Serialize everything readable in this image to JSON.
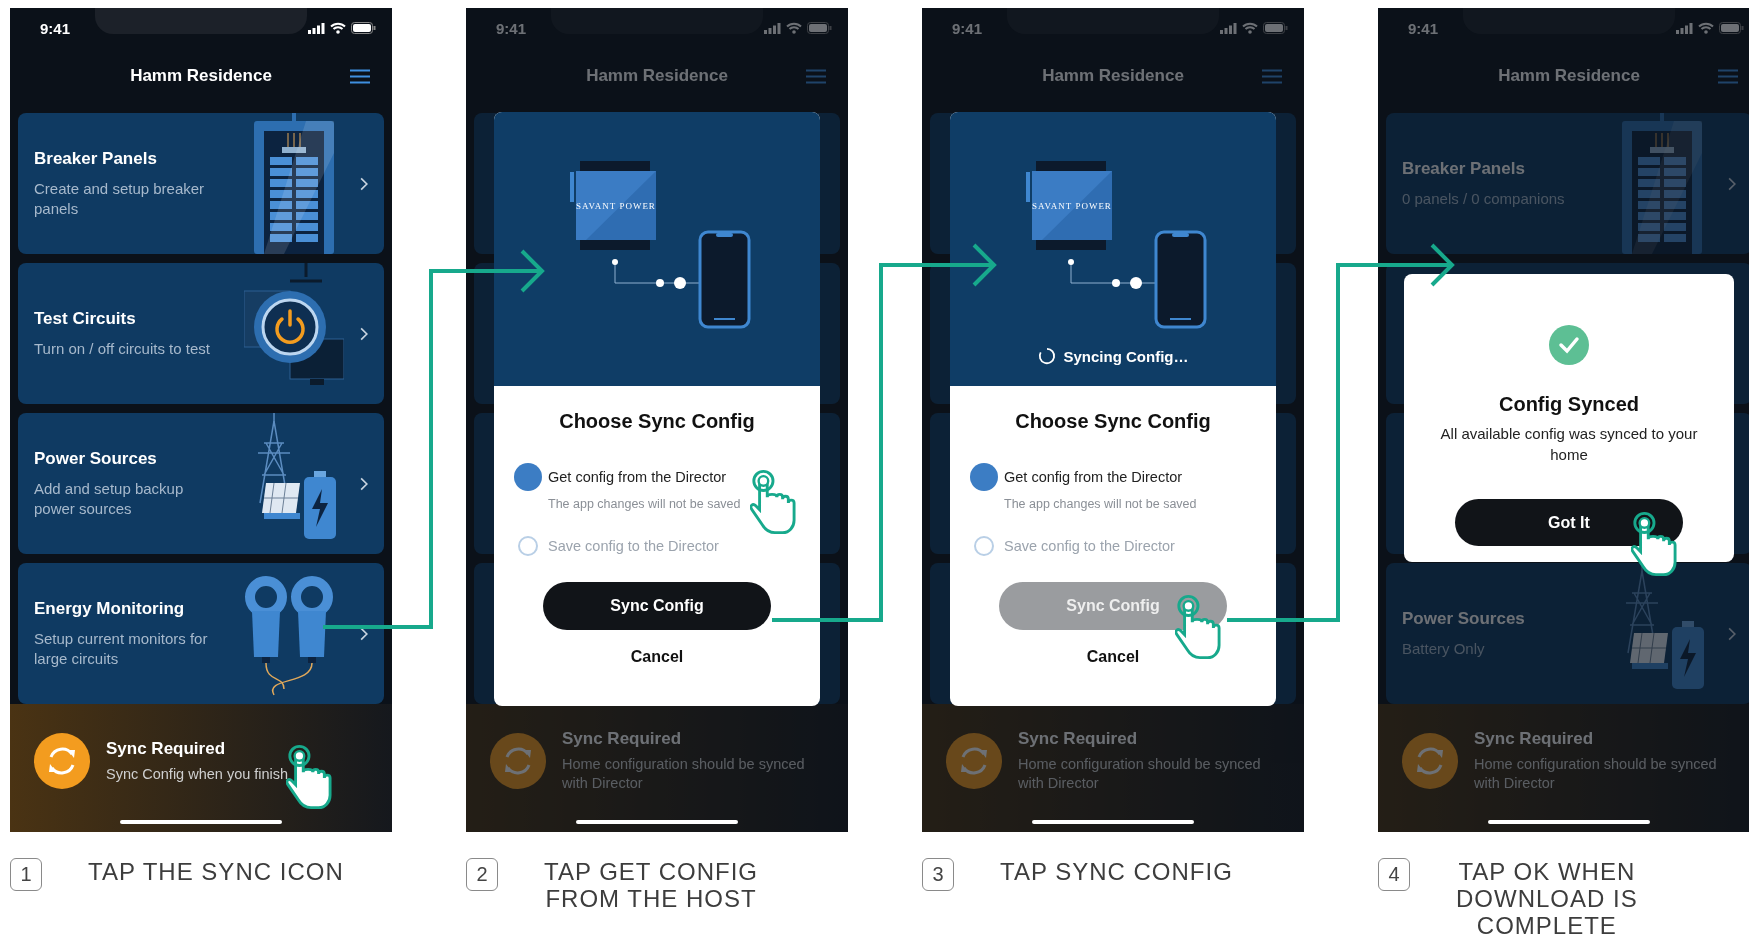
{
  "steps": [
    {
      "number": "1",
      "caption": [
        "TAP THE SYNC ICON"
      ],
      "phone": {
        "time": "9:41",
        "title": "Hamm Residence",
        "cards": [
          {
            "kind": "breaker",
            "title": "Breaker Panels",
            "subtitle": "Create and setup breaker panels"
          },
          {
            "kind": "circuits",
            "title": "Test Circuits",
            "subtitle": "Turn on / off circuits to test"
          },
          {
            "kind": "power",
            "title": "Power Sources",
            "subtitle": "Add and setup backup power sources"
          },
          {
            "kind": "energy",
            "title": "Energy Monitoring",
            "subtitle": "Setup current monitors for large circuits"
          }
        ],
        "banner": {
          "title": "Sync Required",
          "subtitle": "Sync Config when you finish",
          "tapped": true
        }
      }
    },
    {
      "number": "2",
      "caption": [
        "TAP GET CONFIG",
        "FROM THE HOST"
      ],
      "phone": {
        "time": "9:41",
        "title": "Hamm Residence",
        "cards": [
          {
            "kind": "blank"
          },
          {
            "kind": "blank"
          },
          {
            "kind": "blank"
          },
          {
            "kind": "blank"
          }
        ],
        "banner": {
          "title": "Sync Required",
          "subtitle": "Home configuration should be synced with Director",
          "tapped": false
        }
      },
      "dialog": {
        "kind": "choose",
        "device_label": "SAVANT POWER",
        "title": "Choose Sync Config",
        "options": [
          {
            "label": "Get config from the Director",
            "hint": "The app changes will not be saved",
            "selected": true,
            "tapped": true
          },
          {
            "label": "Save config to the Director",
            "selected": false,
            "tapped": false
          }
        ],
        "button": {
          "label": "Sync Config",
          "disabled": false,
          "tapped": false
        },
        "cancel": "Cancel"
      }
    },
    {
      "number": "3",
      "caption": [
        "TAP SYNC CONFIG"
      ],
      "phone": {
        "time": "9:41",
        "title": "Hamm Residence",
        "cards": [
          {
            "kind": "blank"
          },
          {
            "kind": "blank"
          },
          {
            "kind": "blank"
          },
          {
            "kind": "blank"
          }
        ],
        "banner": {
          "title": "Sync Required",
          "subtitle": "Home configuration should be synced with Director",
          "tapped": false
        }
      },
      "dialog": {
        "kind": "choose",
        "device_label": "SAVANT POWER",
        "status": "Syncing Config…",
        "title": "Choose Sync Config",
        "options": [
          {
            "label": "Get config from the Director",
            "hint": "The app changes will not be saved",
            "selected": true,
            "tapped": false
          },
          {
            "label": "Save config to the Director",
            "selected": false,
            "tapped": false
          }
        ],
        "button": {
          "label": "Sync Config",
          "disabled": true,
          "tapped": true
        },
        "cancel": "Cancel"
      }
    },
    {
      "number": "4",
      "caption": [
        "TAP OK WHEN",
        "DOWNLOAD IS",
        "COMPLETE"
      ],
      "phone": {
        "time": "9:41",
        "title": "Hamm Residence",
        "cards": [
          {
            "kind": "breaker",
            "title": "Breaker Panels",
            "subtitle": "0 panels / 0 companions"
          },
          {
            "kind": "blank"
          },
          {
            "kind": "blank"
          },
          {
            "kind": "power",
            "title": "Power Sources",
            "subtitle": "Battery Only"
          }
        ],
        "banner": {
          "title": "Sync Required",
          "subtitle": "Home configuration should be synced with Director",
          "tapped": false
        }
      },
      "dialog": {
        "kind": "done",
        "title": "Config Synced",
        "message": "All available config was synced to your home",
        "button": {
          "label": "Got It",
          "disabled": false,
          "tapped": true
        }
      }
    }
  ]
}
